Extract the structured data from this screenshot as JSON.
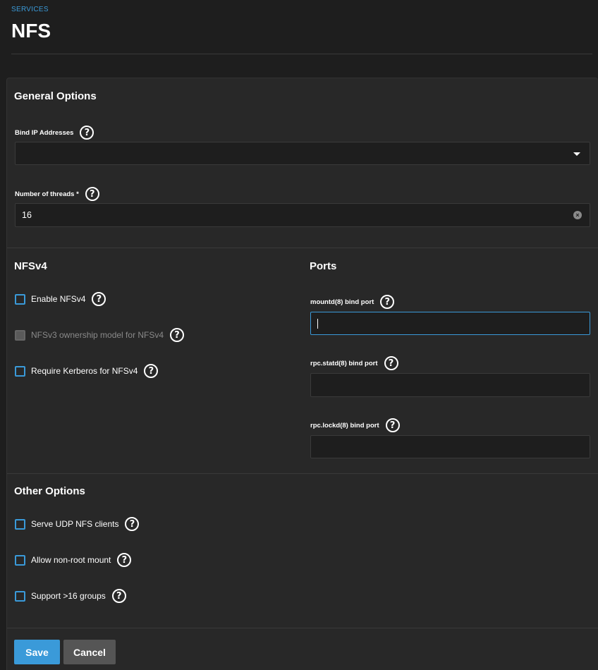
{
  "header": {
    "breadcrumb": "SERVICES",
    "title": "NFS"
  },
  "general": {
    "title": "General Options",
    "bind_ip_label": "Bind IP Addresses",
    "bind_ip_value": "",
    "threads_label": "Number of threads *",
    "threads_value": "16"
  },
  "nfsv4": {
    "title": "NFSv4",
    "items": [
      {
        "label": "Enable NFSv4",
        "checked": false,
        "disabled": false
      },
      {
        "label": "NFSv3 ownership model for NFSv4",
        "checked": false,
        "disabled": true
      },
      {
        "label": "Require Kerberos for NFSv4",
        "checked": false,
        "disabled": false
      }
    ]
  },
  "ports": {
    "title": "Ports",
    "mountd_label": "mountd(8) bind port",
    "statd_label": "rpc.statd(8) bind port",
    "lockd_label": "rpc.lockd(8) bind port"
  },
  "other": {
    "title": "Other Options",
    "items": [
      {
        "label": "Serve UDP NFS clients",
        "checked": false
      },
      {
        "label": "Allow non-root mount",
        "checked": false
      },
      {
        "label": "Support >16 groups",
        "checked": false
      }
    ]
  },
  "actions": {
    "save": "Save",
    "cancel": "Cancel"
  },
  "icons": {
    "help": "help-circle-icon",
    "dropdown": "chevron-down-icon",
    "clear": "clear-icon"
  },
  "colors": {
    "accent": "#3a9ad9",
    "background": "#1e1e1e",
    "card": "#282828"
  }
}
